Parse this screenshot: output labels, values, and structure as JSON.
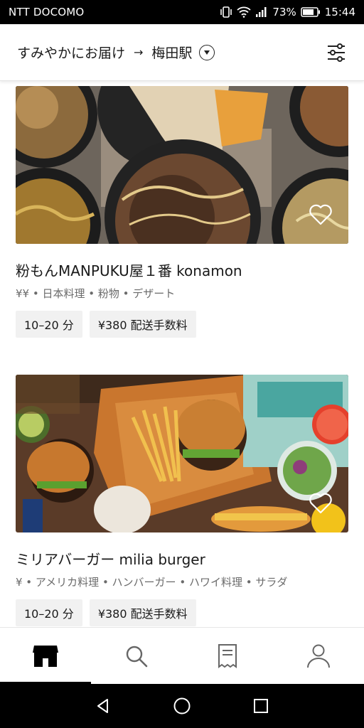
{
  "status_bar": {
    "carrier": "NTT DOCOMO",
    "battery": "73%",
    "time": "15:44"
  },
  "header": {
    "delivery_mode": "すみやかにお届け",
    "arrow": "→",
    "location": "梅田駅"
  },
  "restaurants": [
    {
      "name": "粉もんMANPUKU屋１番 konamon",
      "meta": "¥¥ • 日本料理 • 粉物 • デザート",
      "eta": "10–20 分",
      "fee": "¥380 配送手数料"
    },
    {
      "name": "ミリアバーガー milia burger",
      "meta": "¥ • アメリカ料理 • ハンバーガー • ハワイ料理 • サラダ",
      "eta": "10–20 分",
      "fee": "¥380 配送手数料"
    }
  ],
  "bottom_nav": {
    "items": [
      "home-icon",
      "search-icon",
      "orders-icon",
      "account-icon"
    ],
    "active": "home-icon"
  },
  "colors": {
    "accent": "#000000",
    "tag_bg": "#f1f1f1",
    "meta_text": "#6b6b6b"
  }
}
